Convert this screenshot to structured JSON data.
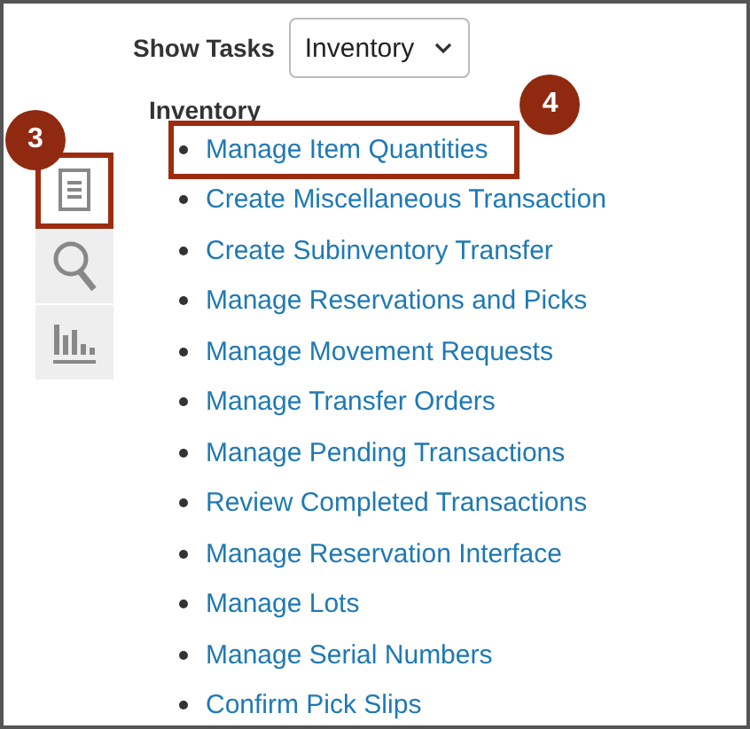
{
  "show_tasks": {
    "label": "Show Tasks",
    "select_value": "Inventory"
  },
  "sidebar": {
    "items": [
      {
        "kind": "tasks",
        "selected": true,
        "callout": "3"
      },
      {
        "kind": "search",
        "selected": false
      },
      {
        "kind": "reports",
        "selected": false
      }
    ]
  },
  "tasks": {
    "heading": "Inventory",
    "items": [
      {
        "label": "Manage Item Quantities",
        "callout": "4"
      },
      {
        "label": "Create Miscellaneous Transaction"
      },
      {
        "label": "Create Subinventory Transfer"
      },
      {
        "label": "Manage Reservations and Picks"
      },
      {
        "label": "Manage Movement Requests"
      },
      {
        "label": "Manage Transfer Orders"
      },
      {
        "label": "Manage Pending Transactions"
      },
      {
        "label": "Review Completed Transactions"
      },
      {
        "label": "Manage Reservation Interface"
      },
      {
        "label": "Manage Lots"
      },
      {
        "label": "Manage Serial Numbers"
      },
      {
        "label": "Confirm Pick Slips"
      }
    ]
  }
}
